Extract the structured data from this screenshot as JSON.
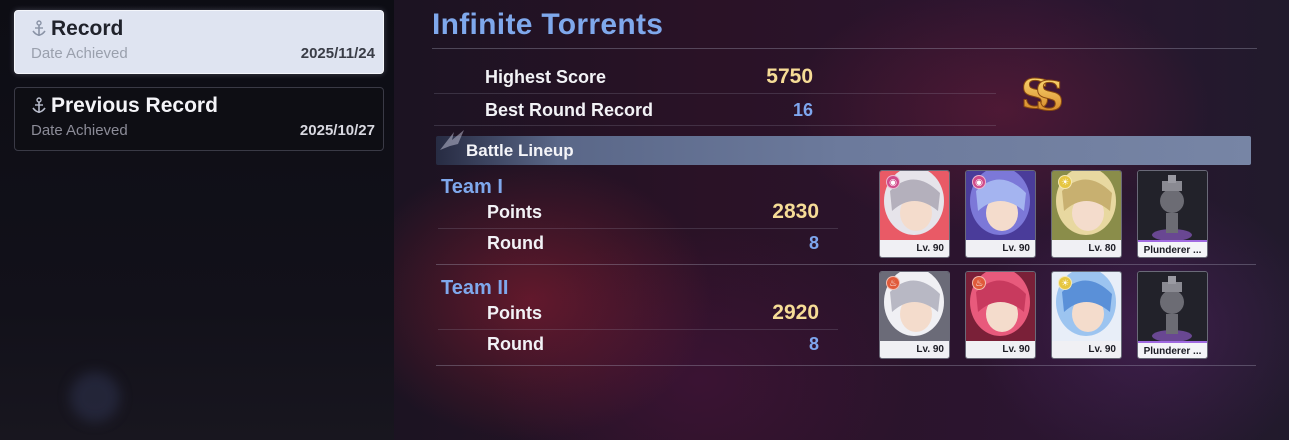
{
  "records": [
    {
      "label": "Record",
      "date_label": "Date Achieved",
      "date": "2025/11/24",
      "active": true
    },
    {
      "label": "Previous Record",
      "date_label": "Date Achieved",
      "date": "2025/10/27",
      "active": false
    }
  ],
  "title": "Infinite Torrents",
  "summary": {
    "highest_score_label": "Highest Score",
    "highest_score": "5750",
    "best_round_label": "Best Round Record",
    "best_round": "16"
  },
  "lineup_label": "Battle Lineup",
  "teams": [
    {
      "name": "Team I",
      "points_label": "Points",
      "points": "2830",
      "round_label": "Round",
      "round": "8",
      "members": [
        {
          "level": "Lv. 90",
          "element": "psyche",
          "colors": [
            "#e6e4ea",
            "#b4b0bc",
            "#e95a66"
          ]
        },
        {
          "level": "Lv. 90",
          "element": "psyche",
          "colors": [
            "#7c78d8",
            "#a4b4f0",
            "#4a3c9a"
          ]
        },
        {
          "level": "Lv. 80",
          "element": "light",
          "colors": [
            "#e8d8a0",
            "#c8b070",
            "#8a8d4a"
          ]
        },
        {
          "level": "Plunderer ...",
          "element": "relic",
          "colors": [
            "#2a2a32",
            "#6c6c74",
            "#9a60d8"
          ]
        }
      ]
    },
    {
      "name": "Team II",
      "points_label": "Points",
      "points": "2920",
      "round_label": "Round",
      "round": "8",
      "members": [
        {
          "level": "Lv. 90",
          "element": "fire",
          "colors": [
            "#f0f0f4",
            "#b8b8c4",
            "#6b6b78"
          ]
        },
        {
          "level": "Lv. 90",
          "element": "fire",
          "colors": [
            "#e85a7c",
            "#c83a5e",
            "#7a2038"
          ]
        },
        {
          "level": "Lv. 90",
          "element": "light",
          "colors": [
            "#9cc4f0",
            "#5a90d8",
            "#e8eef8"
          ]
        },
        {
          "level": "Plunderer ...",
          "element": "relic",
          "colors": [
            "#2a2a32",
            "#6c6c74",
            "#9a60d8"
          ]
        }
      ]
    }
  ],
  "colors": {
    "accent_blue": "#7fa8ec",
    "score_gold": "#f6dc96",
    "round_blue": "#7ea6ee",
    "relic_purple": "#a06ae0"
  },
  "icons": {
    "record": "anchor-icon",
    "badge": "s-rank-icon",
    "psyche": "psyche-element-icon",
    "light": "light-element-icon",
    "fire": "fire-element-icon"
  }
}
